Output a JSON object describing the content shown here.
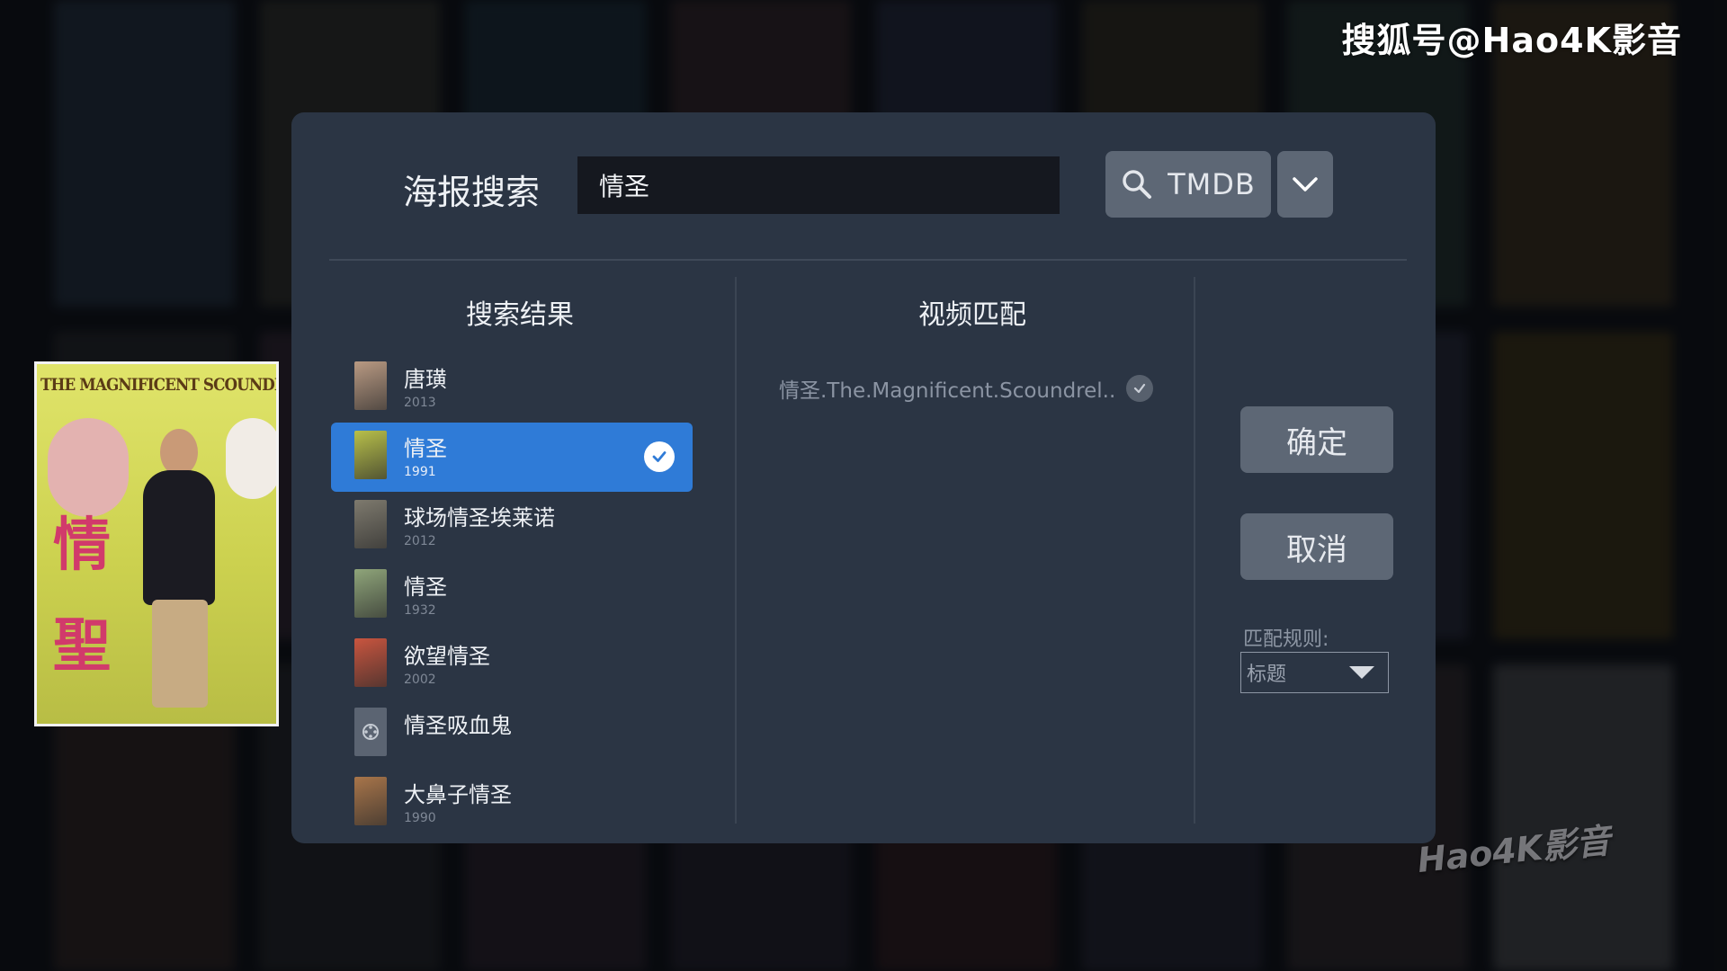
{
  "watermarks": {
    "top": "搜狐号@Hao4K影音",
    "bottom": "Hao4K影音"
  },
  "preview": {
    "poster_title": "THE MAGNIFICENT SCOUNDRELS",
    "poster_chars": [
      "情",
      "聖"
    ]
  },
  "dialog": {
    "title": "海报搜索",
    "search": {
      "value": "情圣",
      "placeholder": ""
    },
    "provider": {
      "label": "TMDB"
    },
    "results_heading": "搜索结果",
    "match_heading": "视频匹配",
    "results": [
      {
        "title": "唐璜",
        "year": "2013",
        "selected": false,
        "thumb": "#b99a83"
      },
      {
        "title": "情圣",
        "year": "1991",
        "selected": true,
        "thumb": "#b8c04a"
      },
      {
        "title": "球场情圣埃莱诺",
        "year": "2012",
        "selected": false,
        "thumb": "#7e7a6e"
      },
      {
        "title": "情圣",
        "year": "1932",
        "selected": false,
        "thumb": "#8fa57a"
      },
      {
        "title": "欲望情圣",
        "year": "2002",
        "selected": false,
        "thumb": "#c9553f"
      },
      {
        "title": "情圣吸血鬼",
        "year": "",
        "selected": false,
        "thumb": "#5b6472"
      },
      {
        "title": "大鼻子情圣",
        "year": "1990",
        "selected": false,
        "thumb": "#a8754a"
      }
    ],
    "match": {
      "filename": "情圣.The.Magnificent.Scoundrel.."
    },
    "confirm_label": "确定",
    "cancel_label": "取消",
    "rule": {
      "label": "匹配规则:",
      "value": "标题"
    }
  },
  "colors": {
    "dialog_bg": "#2b3544",
    "accent": "#2f7bd7",
    "button_bg": "#5d6775"
  }
}
